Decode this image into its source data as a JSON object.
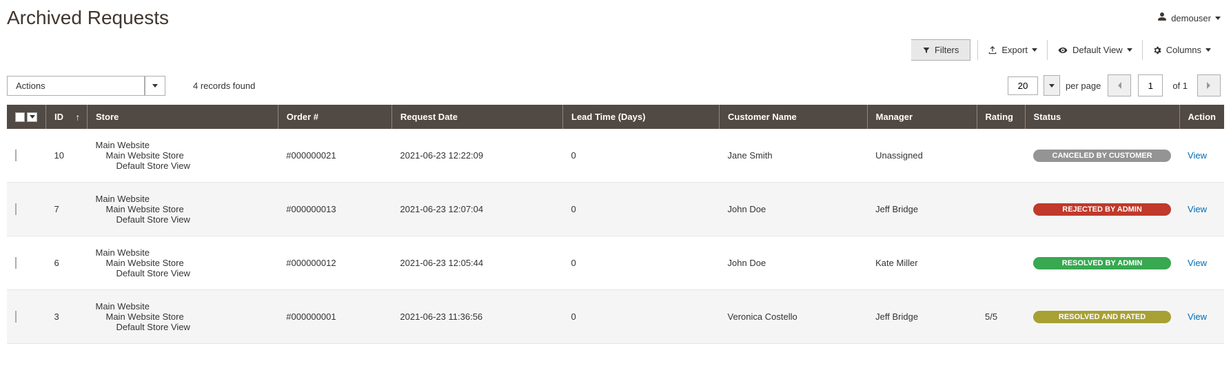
{
  "page": {
    "title": "Archived Requests"
  },
  "user": {
    "name": "demouser"
  },
  "toolbar": {
    "filters": "Filters",
    "export": "Export",
    "default_view": "Default View",
    "columns": "Columns"
  },
  "grid": {
    "actions_label": "Actions",
    "records_found": "4 records found",
    "per_page_value": "20",
    "per_page_label": "per page",
    "current_page": "1",
    "total_pages": "of 1"
  },
  "columns": {
    "id": "ID",
    "store": "Store",
    "order": "Order #",
    "request_date": "Request Date",
    "lead_time": "Lead Time (Days)",
    "customer_name": "Customer Name",
    "manager": "Manager",
    "rating": "Rating",
    "status": "Status",
    "action": "Action"
  },
  "store_hierarchy": {
    "l1": "Main Website",
    "l2": "Main Website Store",
    "l3": "Default Store View"
  },
  "rows": [
    {
      "id": "10",
      "order": "#000000021",
      "request_date": "2021-06-23 12:22:09",
      "lead_time": "0",
      "customer": "Jane Smith",
      "manager": "Unassigned",
      "rating": "",
      "status": "CANCELED BY CUSTOMER",
      "status_color": "#949494",
      "action": "View"
    },
    {
      "id": "7",
      "order": "#000000013",
      "request_date": "2021-06-23 12:07:04",
      "lead_time": "0",
      "customer": "John Doe",
      "manager": "Jeff Bridge",
      "rating": "",
      "status": "REJECTED BY ADMIN",
      "status_color": "#c0392b",
      "action": "View"
    },
    {
      "id": "6",
      "order": "#000000012",
      "request_date": "2021-06-23 12:05:44",
      "lead_time": "0",
      "customer": "John Doe",
      "manager": "Kate Miller",
      "rating": "",
      "status": "RESOLVED BY ADMIN",
      "status_color": "#38a851",
      "action": "View"
    },
    {
      "id": "3",
      "order": "#000000001",
      "request_date": "2021-06-23 11:36:56",
      "lead_time": "0",
      "customer": "Veronica Costello",
      "manager": "Jeff Bridge",
      "rating": "5/5",
      "status": "RESOLVED AND RATED",
      "status_color": "#a7a035",
      "action": "View"
    }
  ]
}
